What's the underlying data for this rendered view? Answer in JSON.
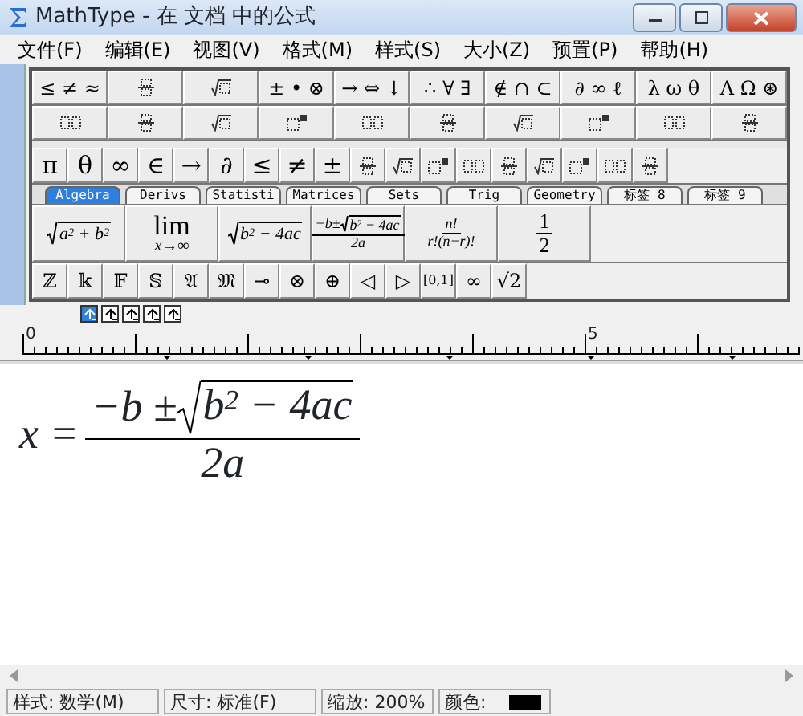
{
  "window": {
    "title": "MathType - 在 文档 中的公式"
  },
  "menu": [
    "文件(F)",
    "编辑(E)",
    "视图(V)",
    "格式(M)",
    "样式(S)",
    "大小(Z)",
    "预置(P)",
    "帮助(H)"
  ],
  "palette": {
    "symbol_rows": [
      [
        {
          "kind": "text",
          "text": "≤ ≠ ≈"
        },
        {
          "kind": "icon"
        },
        {
          "kind": "icon"
        },
        {
          "kind": "text",
          "text": "± • ⊗"
        },
        {
          "kind": "text",
          "text": "→ ⇔ ↓"
        },
        {
          "kind": "text",
          "text": "∴ ∀ ∃"
        },
        {
          "kind": "text",
          "text": "∉ ∩ ⊂"
        },
        {
          "kind": "text",
          "text": "∂ ∞ ℓ"
        },
        {
          "kind": "text",
          "text": "λ ω θ"
        },
        {
          "kind": "text",
          "text": "Λ Ω ⊛"
        }
      ],
      [
        {
          "kind": "icon"
        },
        {
          "kind": "icon"
        },
        {
          "kind": "icon"
        },
        {
          "kind": "icon"
        },
        {
          "kind": "icon"
        },
        {
          "kind": "icon"
        },
        {
          "kind": "icon"
        },
        {
          "kind": "icon"
        },
        {
          "kind": "icon"
        },
        {
          "kind": "icon"
        }
      ]
    ],
    "small_row": [
      {
        "kind": "text",
        "text": "π"
      },
      {
        "kind": "text",
        "text": "θ"
      },
      {
        "kind": "text",
        "text": "∞"
      },
      {
        "kind": "text",
        "text": "∈"
      },
      {
        "kind": "text",
        "text": "→"
      },
      {
        "kind": "text",
        "text": "∂"
      },
      {
        "kind": "text",
        "text": "≤"
      },
      {
        "kind": "text",
        "text": "≠"
      },
      {
        "kind": "text",
        "text": "±"
      },
      {
        "kind": "icon"
      },
      {
        "kind": "icon"
      },
      {
        "kind": "icon"
      },
      {
        "kind": "icon"
      },
      {
        "kind": "icon"
      },
      {
        "kind": "icon"
      },
      {
        "kind": "icon"
      },
      {
        "kind": "icon"
      },
      {
        "kind": "icon"
      }
    ],
    "tabs": [
      {
        "label": "Algebra",
        "selected": true
      },
      {
        "label": "Derivs",
        "selected": false
      },
      {
        "label": "Statisti",
        "selected": false
      },
      {
        "label": "Matrices",
        "selected": false
      },
      {
        "label": "Sets",
        "selected": false
      },
      {
        "label": "Trig",
        "selected": false
      },
      {
        "label": "Geometry",
        "selected": false
      },
      {
        "label": "标签 8",
        "selected": false
      },
      {
        "label": "标签 9",
        "selected": false
      }
    ],
    "templates": [
      {
        "kind": "sqrt",
        "radicand": "a$^{2}$ + b$^{2}$"
      },
      {
        "kind": "limit",
        "top": "lim",
        "bottom": "x→∞"
      },
      {
        "kind": "sqrt",
        "radicand": "b$^{2}$ − 4ac"
      },
      {
        "kind": "fraction",
        "numerator": "−b±",
        "radicand": "b$^{2}$ − 4ac",
        "denominator": "2a"
      },
      {
        "kind": "fraction",
        "numerator": "n!",
        "denominator": "r!(n−r)!"
      },
      {
        "kind": "fraction",
        "numerator": "1",
        "denominator": "2"
      }
    ],
    "extra_row": [
      "ℤ",
      "𝕜",
      "𝔽",
      "𝕊",
      "𝔄",
      "𝔐",
      "⊸",
      "⊗",
      "⊕",
      "◁",
      "▷",
      "[0,1]",
      "∞",
      "√2"
    ]
  },
  "nudge_buttons": [
    {
      "selected": true
    },
    {
      "selected": false
    },
    {
      "selected": false
    },
    {
      "selected": false
    },
    {
      "selected": false
    }
  ],
  "ruler": {
    "labels": [
      "0",
      "5"
    ]
  },
  "equation": {
    "lhs": "x =",
    "numerator": "−b ±",
    "radicand": "b$^{2}$ − 4ac",
    "denominator": "2a"
  },
  "status_bar": {
    "style": "样式: 数学(M)",
    "size": "尺寸: 标准(F)",
    "zoom": "缩放: 200%",
    "color_label": "颜色:",
    "color": "#000000"
  }
}
